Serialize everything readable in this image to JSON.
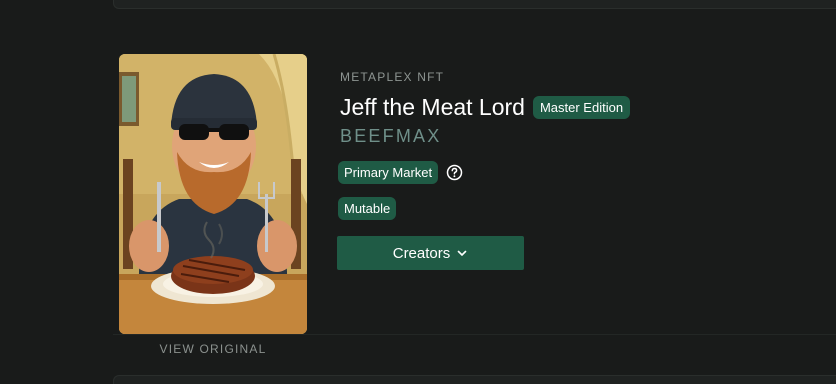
{
  "nft": {
    "collection_label": "METAPLEX NFT",
    "title": "Jeff the Meat Lord",
    "edition_badge": "Master Edition",
    "symbol": "BEEFMAX",
    "market_badge": "Primary Market",
    "mutable_badge": "Mutable",
    "creators_label": "Creators",
    "view_original_label": "VIEW ORIGINAL"
  },
  "icons": {
    "help": "help-circle-icon",
    "chevron": "chevron-down-icon"
  },
  "colors": {
    "background": "#191b1a",
    "badge": "#1f5b45",
    "symbol": "#6f8f89",
    "muted_text": "#8e9592"
  }
}
